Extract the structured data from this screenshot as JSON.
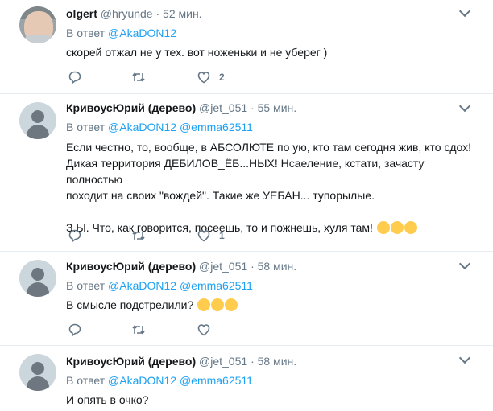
{
  "tweets": [
    {
      "name": "olgert",
      "handle": "@hryunde",
      "separator": "·",
      "time": "52 мин.",
      "reply_prefix": "В ответ",
      "mentions": [
        "@AkaDON12"
      ],
      "text": "скорей отжал не у тех. вот ноженьки и не уберег )",
      "likes": "2",
      "avatar": "photo"
    },
    {
      "name": "КривоусЮрий (дерево)",
      "handle": "@jet_051",
      "separator": "·",
      "time": "55 мин.",
      "reply_prefix": "В ответ",
      "mentions": [
        "@AkaDON12",
        "@emma62511"
      ],
      "text_line1": "Если честно, то, вообще, в АБСОЛЮТЕ по ую, кто там сегодня жив, кто сдох!",
      "text_line2": "Дикая территория ДЕБИЛОВ_ЁБ...НЫХ! Нсаеление, кстати, зачасту полностью",
      "text_line3": "походит на своих \"вождей\". Такие же УЕБАН... тупорылые.",
      "text_line4": "З.Ы. Что, как говорится, посеешь, то и пожнешь, хуля там!",
      "replies": "1",
      "avatar": "default"
    },
    {
      "name": "КривоусЮрий (дерево)",
      "handle": "@jet_051",
      "separator": "·",
      "time": "58 мин.",
      "reply_prefix": "В ответ",
      "mentions": [
        "@AkaDON12",
        "@emma62511"
      ],
      "text": "В смысле подстрелили?",
      "avatar": "default"
    },
    {
      "name": "КривоусЮрий (дерево)",
      "handle": "@jet_051",
      "separator": "·",
      "time": "58 мин.",
      "reply_prefix": "В ответ",
      "mentions": [
        "@AkaDON12",
        "@emma62511"
      ],
      "text": "И опять в очко?",
      "avatar": "default"
    }
  ],
  "icons": {
    "reply": "reply-icon",
    "retweet": "retweet-icon",
    "like": "heart-icon",
    "menu": "chevron-down-icon",
    "emoji": "rolling-on-floor-laughing-emoji"
  },
  "colors": {
    "link": "#1da1f2",
    "muted": "#657786",
    "text": "#14171a",
    "divider": "#e6ecf0"
  }
}
